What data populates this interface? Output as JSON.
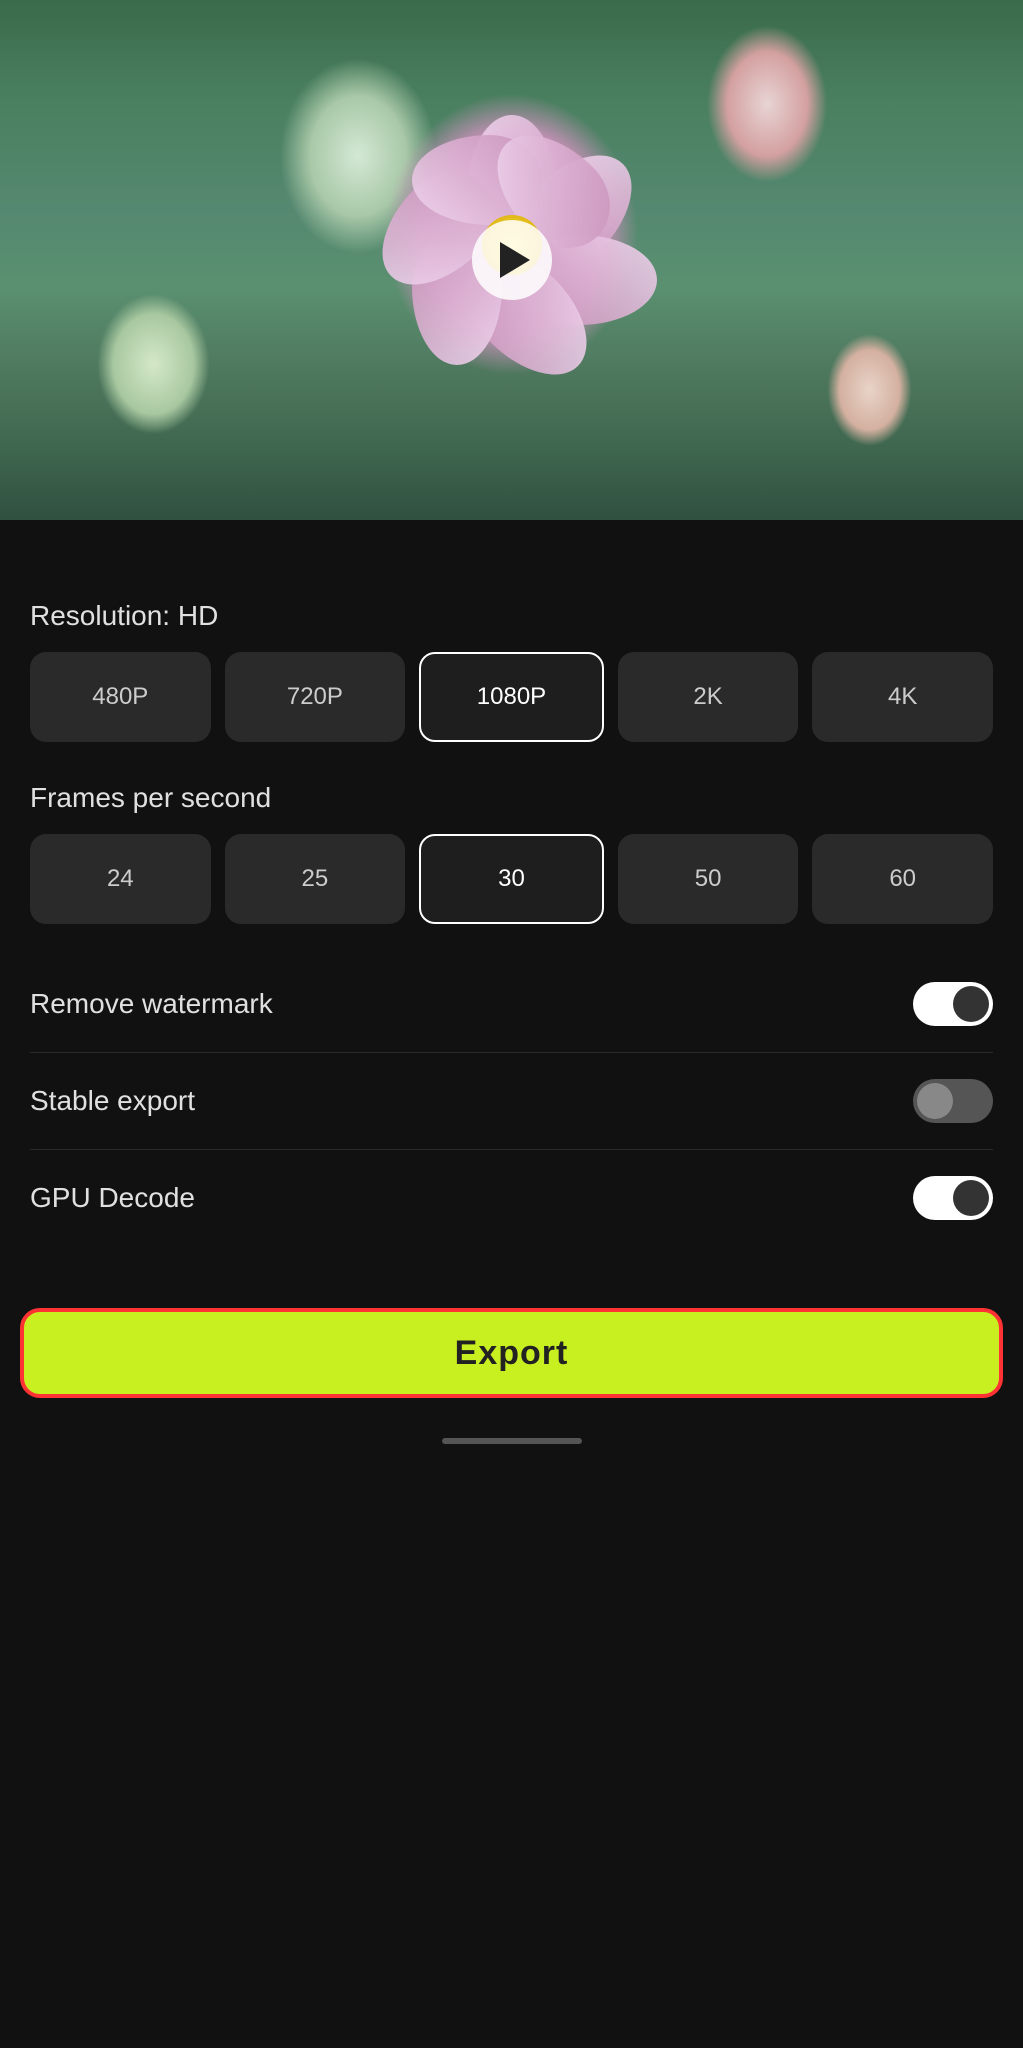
{
  "video": {
    "play_label": "▶"
  },
  "resolution": {
    "label": "Resolution: HD",
    "options": [
      "480P",
      "720P",
      "1080P",
      "2K",
      "4K"
    ],
    "selected_index": 2
  },
  "fps": {
    "label": "Frames per second",
    "options": [
      "24",
      "25",
      "30",
      "50",
      "60"
    ],
    "selected_index": 2
  },
  "toggles": {
    "remove_watermark": {
      "label": "Remove watermark",
      "state": "on"
    },
    "stable_export": {
      "label": "Stable export",
      "state": "off"
    },
    "gpu_decode": {
      "label": "GPU Decode",
      "state": "on"
    }
  },
  "export_button": {
    "label": "Export"
  },
  "colors": {
    "selected_border": "#ffffff",
    "export_bg": "#c8f020",
    "export_border": "#ff3333",
    "toggle_on_bg": "#ffffff",
    "toggle_off_bg": "#555555"
  }
}
